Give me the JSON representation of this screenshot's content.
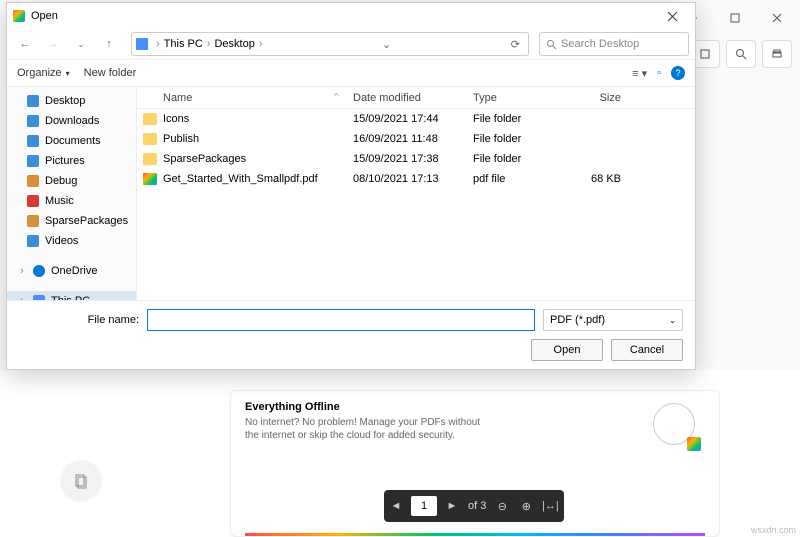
{
  "bg": {
    "card": {
      "title": "Everything Offline",
      "body": "No internet? No problem! Manage your PDFs without the internet or skip the cloud for added security."
    },
    "reader": {
      "page": "1",
      "of": "of 3"
    },
    "watermark": "wsxdn.com"
  },
  "dialog": {
    "title": "Open",
    "breadcrumb": {
      "root": "This PC",
      "folder": "Desktop"
    },
    "search": {
      "placeholder": "Search Desktop"
    },
    "toolbar": {
      "organize": "Organize",
      "newfolder": "New folder"
    },
    "headers": {
      "name": "Name",
      "date": "Date modified",
      "type": "Type",
      "size": "Size"
    },
    "sidebar": {
      "items": [
        {
          "label": "Desktop",
          "cls": "desk"
        },
        {
          "label": "Downloads",
          "cls": "dl"
        },
        {
          "label": "Documents",
          "cls": "doc"
        },
        {
          "label": "Pictures",
          "cls": "pic"
        },
        {
          "label": "Debug",
          "cls": "dbg"
        },
        {
          "label": "Music",
          "cls": "mus"
        },
        {
          "label": "SparsePackages",
          "cls": "sp"
        },
        {
          "label": "Videos",
          "cls": "vid"
        }
      ],
      "onedrive": "OneDrive",
      "thispc": "This PC"
    },
    "files": [
      {
        "name": "Icons",
        "date": "15/09/2021 17:44",
        "type": "File folder",
        "size": "",
        "icon": "folder"
      },
      {
        "name": "Publish",
        "date": "16/09/2021 11:48",
        "type": "File folder",
        "size": "",
        "icon": "folder"
      },
      {
        "name": "SparsePackages",
        "date": "15/09/2021 17:38",
        "type": "File folder",
        "size": "",
        "icon": "folder"
      },
      {
        "name": "Get_Started_With_Smallpdf.pdf",
        "date": "08/10/2021 17:13",
        "type": "pdf file",
        "size": "68 KB",
        "icon": "pdf"
      }
    ],
    "footer": {
      "filename_label": "File name:",
      "filetype": "PDF (*.pdf)",
      "open": "Open",
      "cancel": "Cancel"
    }
  }
}
